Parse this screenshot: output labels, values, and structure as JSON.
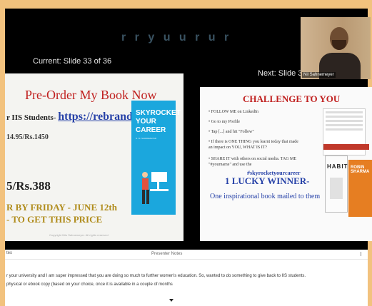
{
  "background_title": "r r y u u r u r",
  "current_slide_label": "Current: Slide 33 of 36",
  "next_slide_label": "Next: Slide 3",
  "webcam": {
    "name_tag": "Nil Sahnemeyer"
  },
  "current_slide": {
    "title": "Pre-Order My Book Now",
    "line1_prefix": "r IIS Students-",
    "line1_link": "https://rebrand.ly/",
    "line2": "14.95/Rs.1450",
    "line3": "5/Rs.388",
    "line4": "R BY FRIDAY - JUNE 12th",
    "line5": "- TO GET THIS PRICE",
    "book_title_1": "SKYROCKET",
    "book_title_2": "YOUR CAREER",
    "book_author": "N. M. SAHNEMEYER",
    "footer": "Copyright Nilu Sahnemeyer. All rights reserved"
  },
  "next_slide": {
    "title": "CHALLENGE TO YOU",
    "bullets": [
      "• FOLLOW ME on LinkedIn",
      "• Go to my Profile",
      "• Tap [...] and hit \"Follow\"",
      "• If there is ONE THING you learnt today that made",
      "   an impact on YOU, WHAT IS IT?",
      "• SHARE IT with others on social media. TAG ME",
      "   \"#yourname\" and use the"
    ],
    "hashtag": "#skyrocketyourcareer",
    "lucky": "1 LUCKY WINNER-",
    "mailed": "One inspirational book mailed to them",
    "book1": "HABIT",
    "book2": "ROBIN SHARMA"
  },
  "notes": {
    "left_label": "tes",
    "center_label": "Presenter Notes",
    "lines": [
      "r your university and I am super impressed that you are doing so much to further women's education. So, wanted to do something to give back to IIS students.",
      "physical or ebook copy (based on your choice, once it is available in a couple of months"
    ]
  }
}
